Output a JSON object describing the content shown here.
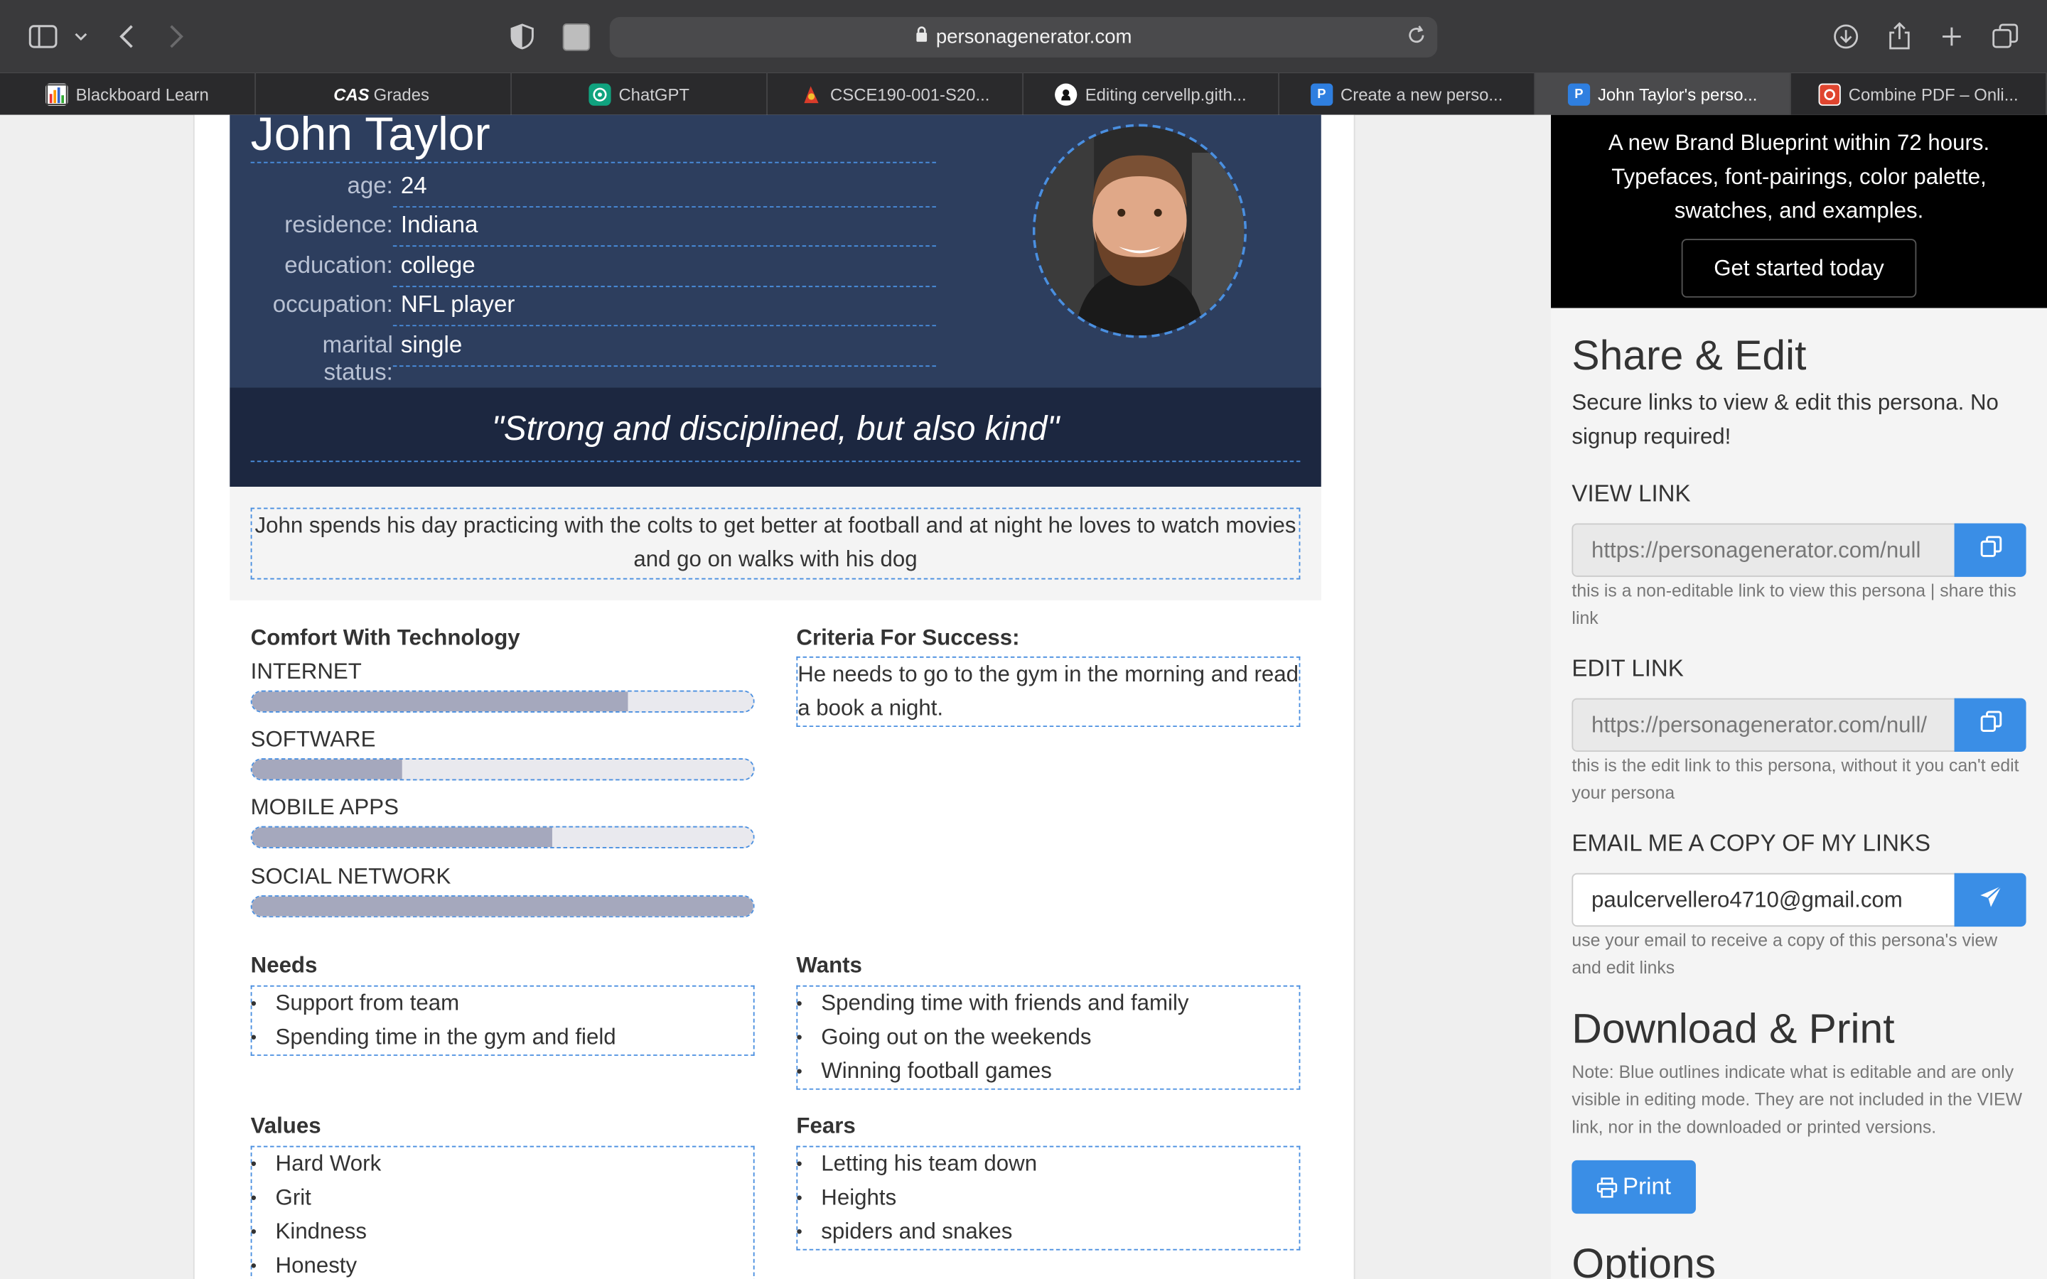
{
  "browser": {
    "url": "personagenerator.com",
    "tabs": [
      {
        "label": "Blackboard Learn",
        "icon": "blackboard-icon",
        "color": "#f2f2f2"
      },
      {
        "label": "Grades",
        "icon": "cas-icon",
        "color": "#ffffff"
      },
      {
        "label": "ChatGPT",
        "icon": "chatgpt-icon",
        "color": "#10a37f"
      },
      {
        "label": "CSCE190-001-S20...",
        "icon": "course-icon",
        "color": "#d93c2a"
      },
      {
        "label": "Editing cervellp.gith...",
        "icon": "github-icon",
        "color": "#ffffff"
      },
      {
        "label": "Create a new perso...",
        "icon": "persona-icon",
        "color": "#2f7fe0"
      },
      {
        "label": "John Taylor's perso...",
        "icon": "persona-icon",
        "color": "#2f7fe0"
      },
      {
        "label": "Combine PDF – Onli...",
        "icon": "pdf-icon",
        "color": "#e0452f"
      }
    ]
  },
  "persona": {
    "name": "John Taylor",
    "fields": [
      {
        "label": "age:",
        "value": "24"
      },
      {
        "label": "residence:",
        "value": "Indiana"
      },
      {
        "label": "education:",
        "value": "college"
      },
      {
        "label": "occupation:",
        "value": "NFL player"
      },
      {
        "label": "marital status:",
        "value": "single"
      }
    ],
    "quote": "\"Strong and disciplined, but also kind\"",
    "bio": "John spends his day practicing with the colts to get better at football and at night he loves to watch movies and go on walks with his dog",
    "tech": {
      "title": "Comfort With Technology",
      "items": [
        {
          "label": "INTERNET",
          "level": 0.75
        },
        {
          "label": "SOFTWARE",
          "level": 0.3
        },
        {
          "label": "MOBILE APPS",
          "level": 0.6
        },
        {
          "label": "SOCIAL NETWORK",
          "level": 1.0
        }
      ]
    },
    "criteria": {
      "title": "Criteria For Success:",
      "text": "He needs to go to the gym in the morning and read a book a night."
    },
    "needs": {
      "title": "Needs",
      "items": [
        "Support from team",
        "Spending time in the gym and field"
      ]
    },
    "wants": {
      "title": "Wants",
      "items": [
        "Spending time with friends and family",
        "Going out on the weekends",
        "Winning football games"
      ]
    },
    "values": {
      "title": "Values",
      "items": [
        "Hard Work",
        "Grit",
        "Kindness",
        "Honesty"
      ]
    },
    "fears": {
      "title": "Fears",
      "items": [
        "Letting his team down",
        "Heights",
        "spiders and snakes"
      ]
    }
  },
  "sidebar": {
    "ad": {
      "text": "A new Brand Blueprint within 72 hours. Typefaces, font-pairings, color palette, swatches, and examples.",
      "button": "Get started today"
    },
    "share": {
      "title": "Share & Edit",
      "desc": "Secure links to view & edit this persona. No signup required!",
      "view_label": "VIEW LINK",
      "view_value": "https://personagenerator.com/null",
      "view_help": "this is a non-editable link to view this persona | share this link",
      "edit_label": "EDIT LINK",
      "edit_value": "https://personagenerator.com/null/",
      "edit_help": "this is the edit link to this persona, without it you can't edit your persona",
      "email_label": "EMAIL ME A COPY OF MY LINKS",
      "email_value": "paulcervellero4710@gmail.com",
      "email_help": "use your email to receive a copy of this persona's view and edit links"
    },
    "download": {
      "title": "Download & Print",
      "note": "Note: Blue outlines indicate what is editable and are only visible in editing mode. They are not included in the VIEW link, nor in the downloaded or printed versions.",
      "print_label": "Print"
    },
    "options_title": "Options"
  }
}
